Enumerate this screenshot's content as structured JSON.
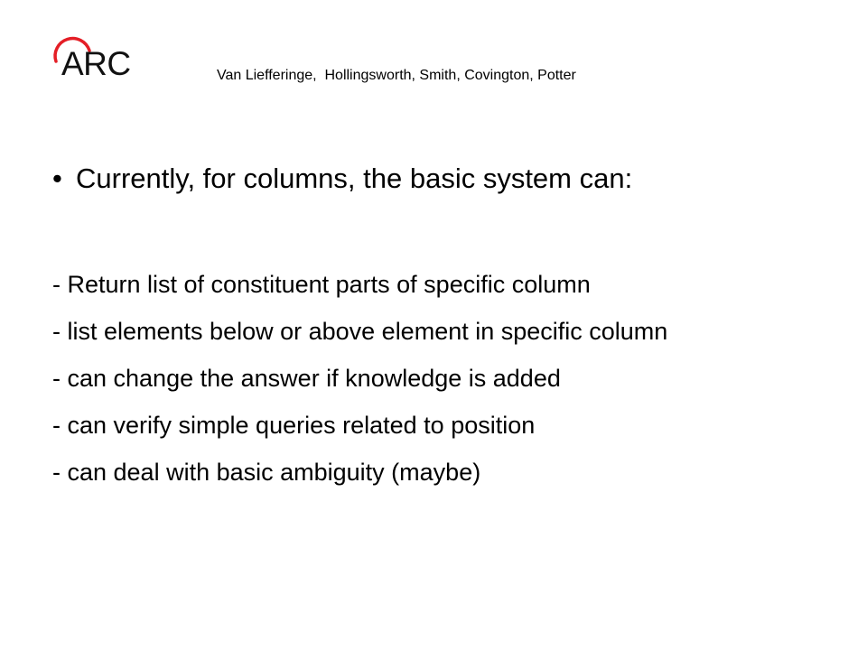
{
  "logo": {
    "text": "ARC",
    "arc_color": "#e41e26"
  },
  "authors": "Van Liefferinge,  Hollingsworth, Smith, Covington, Potter",
  "heading": {
    "bullet": "•",
    "text": "Currently, for columns, the basic system can:"
  },
  "items": [
    "- Return list of constituent parts of specific column",
    "- list elements below or above element in specific column",
    "- can change the answer if knowledge is added",
    "- can verify simple queries related to position",
    "- can deal with basic ambiguity (maybe)"
  ]
}
